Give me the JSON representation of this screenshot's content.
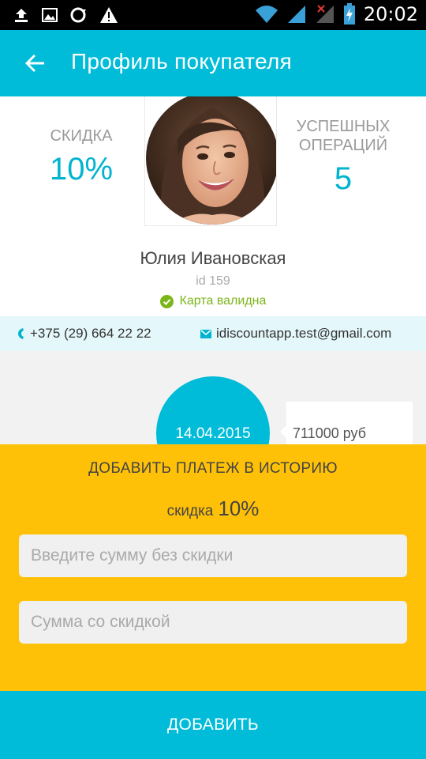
{
  "status_bar": {
    "time": "20:02",
    "icons": [
      "upload-icon",
      "image-icon",
      "sync-icon",
      "warning-icon",
      "wifi-icon",
      "signal-icon",
      "signal-no-sim-icon",
      "battery-charging-icon"
    ]
  },
  "app_bar": {
    "title": "Профиль покупателя",
    "back_icon": "arrow-back-icon"
  },
  "profile": {
    "discount_label": "СКИДКА",
    "discount_value": "10%",
    "operations_label_line1": "УСПЕШНЫХ",
    "operations_label_line2": "ОПЕРАЦИЙ",
    "operations_value": "5",
    "name": "Юлия Ивановская",
    "id": "id 159",
    "card_status": "Карта валидна",
    "card_status_icon": "check-circle-icon"
  },
  "contacts": {
    "phone": "+375 (29) 664 22 22",
    "phone_icon": "phone-icon",
    "email": "idiscountapp.test@gmail.com",
    "email_icon": "mail-icon"
  },
  "history": {
    "date": "14.04.2015",
    "amount": "711000 руб"
  },
  "add_payment": {
    "title": "ДОБАВИТЬ ПЛАТЕЖ В ИСТОРИЮ",
    "discount_label": "скидка",
    "discount_value": "10%",
    "amount_placeholder": "Введите сумму без скидки",
    "discounted_placeholder": "Сумма со скидкой",
    "amount_value": "",
    "discounted_value": ""
  },
  "add_button_label": "ДОБАВИТЬ",
  "colors": {
    "primary": "#00bcd8",
    "accent": "#ffc107",
    "valid": "#7cb518"
  }
}
